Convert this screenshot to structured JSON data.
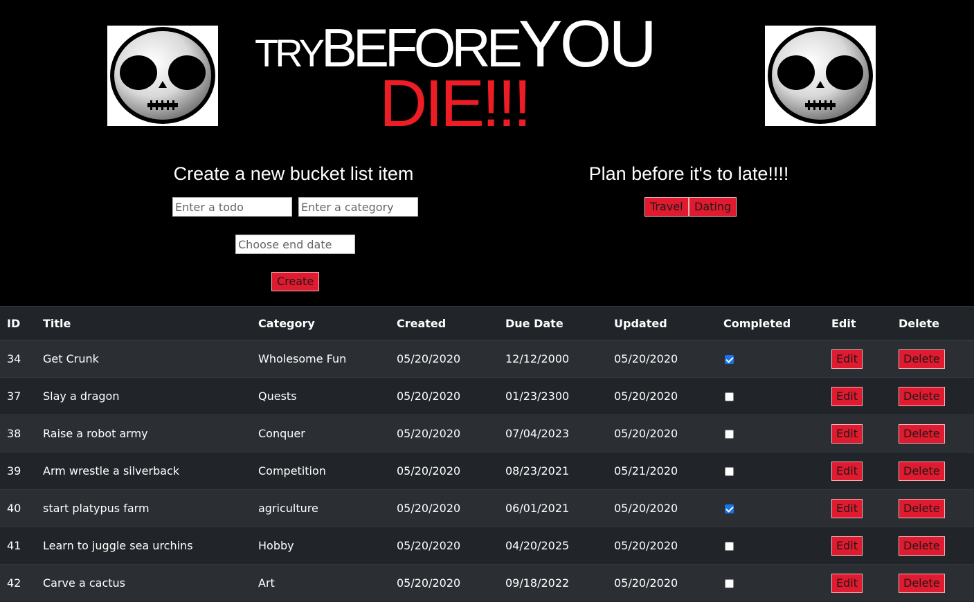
{
  "logo": {
    "try": "TRY",
    "before": "BEFORE",
    "you": "YOU",
    "die": "DIE!!!",
    "die_color": "#ee1c25"
  },
  "images": {
    "left": "skull-icon",
    "right": "skull-icon"
  },
  "create_form": {
    "heading": "Create a new bucket list item",
    "todo_placeholder": "Enter a todo",
    "category_placeholder": "Enter a category",
    "date_placeholder": "Choose end date",
    "create_label": "Create"
  },
  "plan": {
    "heading": "Plan before it's to late!!!!",
    "buttons": [
      "Travel",
      "Dating"
    ]
  },
  "colors": {
    "accent_red": "#e01a2f",
    "table_bg": "#212529",
    "checkbox_checked": "#1a73e8"
  },
  "table": {
    "headers": [
      "ID",
      "Title",
      "Category",
      "Created",
      "Due Date",
      "Updated",
      "Completed",
      "Edit",
      "Delete"
    ],
    "edit_label": "Edit",
    "delete_label": "Delete",
    "rows": [
      {
        "id": "34",
        "title": "Get Crunk",
        "category": "Wholesome Fun",
        "created": "05/20/2020",
        "due": "12/12/2000",
        "updated": "05/20/2020",
        "completed": true
      },
      {
        "id": "37",
        "title": "Slay a dragon",
        "category": "Quests",
        "created": "05/20/2020",
        "due": "01/23/2300",
        "updated": "05/20/2020",
        "completed": false
      },
      {
        "id": "38",
        "title": "Raise a robot army",
        "category": "Conquer",
        "created": "05/20/2020",
        "due": "07/04/2023",
        "updated": "05/20/2020",
        "completed": false
      },
      {
        "id": "39",
        "title": "Arm wrestle a silverback",
        "category": "Competition",
        "created": "05/20/2020",
        "due": "08/23/2021",
        "updated": "05/21/2020",
        "completed": false
      },
      {
        "id": "40",
        "title": "start platypus farm",
        "category": "agriculture",
        "created": "05/20/2020",
        "due": "06/01/2021",
        "updated": "05/20/2020",
        "completed": true
      },
      {
        "id": "41",
        "title": "Learn to juggle sea urchins",
        "category": "Hobby",
        "created": "05/20/2020",
        "due": "04/20/2025",
        "updated": "05/20/2020",
        "completed": false
      },
      {
        "id": "42",
        "title": "Carve a cactus",
        "category": "Art",
        "created": "05/20/2020",
        "due": "09/18/2022",
        "updated": "05/20/2020",
        "completed": false
      }
    ]
  }
}
